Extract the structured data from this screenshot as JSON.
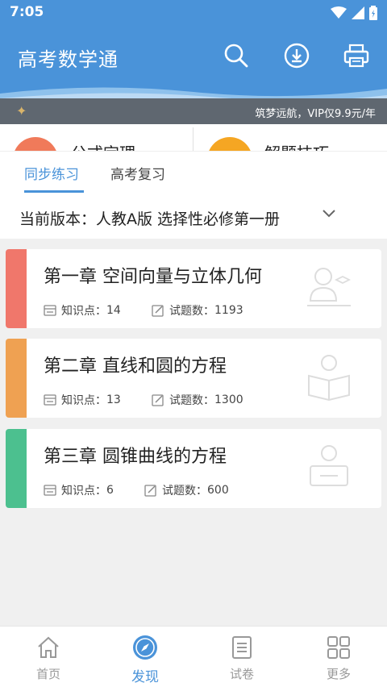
{
  "status_bar": {
    "time": "7:05"
  },
  "header": {
    "title": "高考数学通"
  },
  "vip_banner": {
    "text": "筑梦远航，VIP仅9.9元/年"
  },
  "quick_links": [
    {
      "label": "公式定理",
      "color": "#f07a5a"
    },
    {
      "label": "解题技巧",
      "color": "#f5a623"
    }
  ],
  "tabs": [
    {
      "label": "同步练习",
      "active": true
    },
    {
      "label": "高考复习",
      "active": false
    }
  ],
  "edition": {
    "text": "当前版本：人教A版 选择性必修第一册"
  },
  "chapters": [
    {
      "title": "第一章 空间向量与立体几何",
      "points_label": "知识点：",
      "points": "14",
      "questions_label": "试题数：",
      "questions": "1193",
      "color": "#f0776b"
    },
    {
      "title": "第二章 直线和圆的方程",
      "points_label": "知识点：",
      "points": "13",
      "questions_label": "试题数：",
      "questions": "1300",
      "color": "#efa152"
    },
    {
      "title": "第三章 圆锥曲线的方程",
      "points_label": "知识点：",
      "points": "6",
      "questions_label": "试题数：",
      "questions": "600",
      "color": "#4cc08f"
    }
  ],
  "bottom_nav": [
    {
      "label": "首页",
      "icon": "home-icon",
      "active": false
    },
    {
      "label": "发现",
      "icon": "compass-icon",
      "active": true
    },
    {
      "label": "试卷",
      "icon": "paper-icon",
      "active": false
    },
    {
      "label": "更多",
      "icon": "grid-icon",
      "active": false
    }
  ],
  "colors": {
    "primary": "#4a93d9",
    "banner": "#5f6770"
  }
}
